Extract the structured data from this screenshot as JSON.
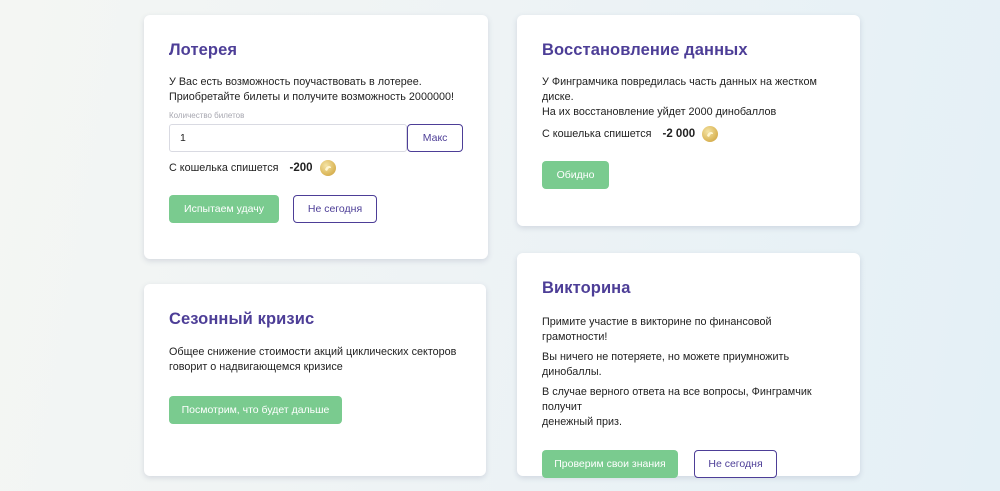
{
  "lottery": {
    "title": "Лотерея",
    "description_lines": [
      "У Вас есть возможность поучаствовать в лотерее.",
      "Приобретайте билеты и получите возможность 2000000!"
    ],
    "quantity_label": "Количество билетов",
    "quantity_value": "1",
    "max_button": "Макс",
    "cost_label": "С кошелька спишется",
    "cost_amount": "-200",
    "primary_button": "Испытаем удачу",
    "secondary_button": "Не сегодня"
  },
  "recovery": {
    "title": "Восстановление данных",
    "description_lines": [
      "У Финграмчика повредилась часть данных на жестком диске.",
      "На их восстановление уйдет 2000 динобаллов"
    ],
    "cost_label": "С кошелька спишется",
    "cost_amount": "-2 000",
    "primary_button": "Обидно"
  },
  "crisis": {
    "title": "Сезонный кризис",
    "description_lines": [
      "Общее снижение стоимости акций циклических секторов",
      "говорит о надвигающемся кризисе"
    ],
    "primary_button": "Посмотрим, что будет дальше"
  },
  "quiz": {
    "title": "Викторина",
    "paragraph_1": "Примите участие в викторине по финансовой грамотности!",
    "paragraph_2_lines": [
      "Вы ничего не потеряете, но можете приумножить",
      "динобаллы."
    ],
    "paragraph_3_lines": [
      "В случае верного ответа на все вопросы, Финграмчик получит",
      "денежный приз."
    ],
    "primary_button": "Проверим свои знания",
    "secondary_button": "Не сегодня"
  },
  "coin_icon": "dino-coin-icon",
  "colors": {
    "title": "#4d3e97",
    "green_button": "#7acb8f",
    "outline": "#4d3e97",
    "coin": "#dfbd63"
  }
}
